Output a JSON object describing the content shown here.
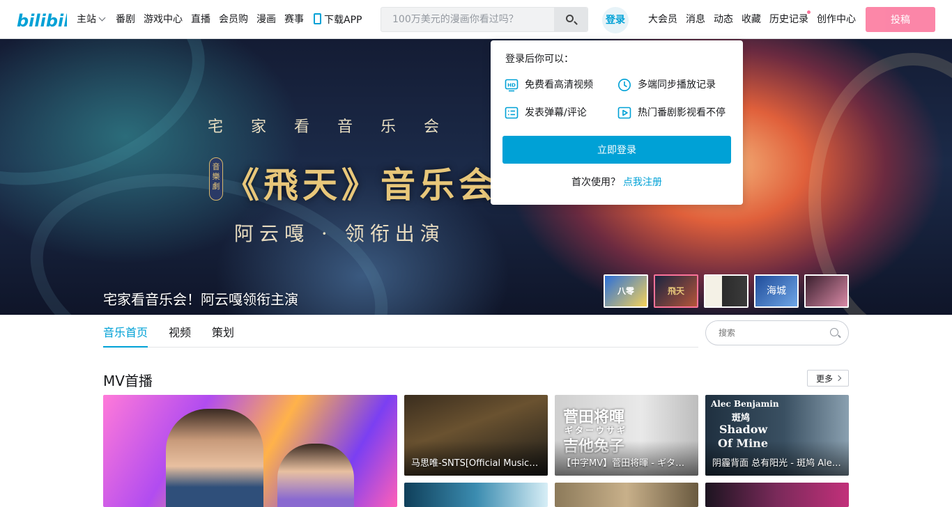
{
  "header": {
    "logo_text": "bilibili",
    "nav": [
      {
        "label": "主站"
      },
      {
        "label": "番剧"
      },
      {
        "label": "游戏中心"
      },
      {
        "label": "直播"
      },
      {
        "label": "会员购"
      },
      {
        "label": "漫画"
      },
      {
        "label": "赛事"
      },
      {
        "label": "下载APP"
      }
    ],
    "search_placeholder": "100万美元的漫画你看过吗？",
    "login": "登录",
    "right_nav": [
      {
        "label": "大会员"
      },
      {
        "label": "消息"
      },
      {
        "label": "动态"
      },
      {
        "label": "收藏"
      },
      {
        "label": "历史记录"
      },
      {
        "label": "创作中心"
      }
    ],
    "upload": "投稿"
  },
  "banner": {
    "sub": "宅家看音乐会",
    "tag": "音樂劇",
    "title": "《飛天》音乐会",
    "cast": "阿云嘎 · 领衔出演",
    "caption": "宅家看音乐会！阿云嘎领衔主演",
    "thumbs": [
      {
        "label": "八零"
      },
      {
        "label": "飛天"
      },
      {
        "label": ""
      },
      {
        "label": "海城"
      },
      {
        "label": ""
      }
    ]
  },
  "login_popup": {
    "title": "登录后你可以：",
    "perks": [
      {
        "label": "免费看高清视频",
        "icon": "hd-icon"
      },
      {
        "label": "多端同步播放记录",
        "icon": "clock-icon"
      },
      {
        "label": "发表弹幕/评论",
        "icon": "list-icon"
      },
      {
        "label": "热门番剧影视看不停",
        "icon": "play-icon"
      }
    ],
    "login_button": "立即登录",
    "register_prompt": "首次使用？",
    "register_link": "点我注册"
  },
  "subnav": {
    "tabs": [
      {
        "label": "音乐首页"
      },
      {
        "label": "视频"
      },
      {
        "label": "策划"
      }
    ],
    "search_placeholder": "搜索"
  },
  "mv": {
    "title": "MV首播",
    "more": "更多",
    "cards": [
      {
        "title": ""
      },
      {
        "title": "马思唯-SNTS[Official Music Video]"
      },
      {
        "title": "【中字MV】菅田将暉 - ギターウサギ"
      },
      {
        "title": "阴霾背面 总有阳光 - 斑鸠 Alec Benjamin"
      }
    ],
    "card_art": {
      "c2_line1": "菅田将暉",
      "c2_line2": "ギターウサギ",
      "c2_line3": "吉他兔子",
      "c3_line1": "Alec Benjamin",
      "c3_line2": "斑鸠",
      "c3_line3": "Shadow",
      "c3_line4": "Of Mine"
    }
  },
  "colors": {
    "brand_blue": "#00a1d6",
    "brand_pink": "#fb7299"
  }
}
